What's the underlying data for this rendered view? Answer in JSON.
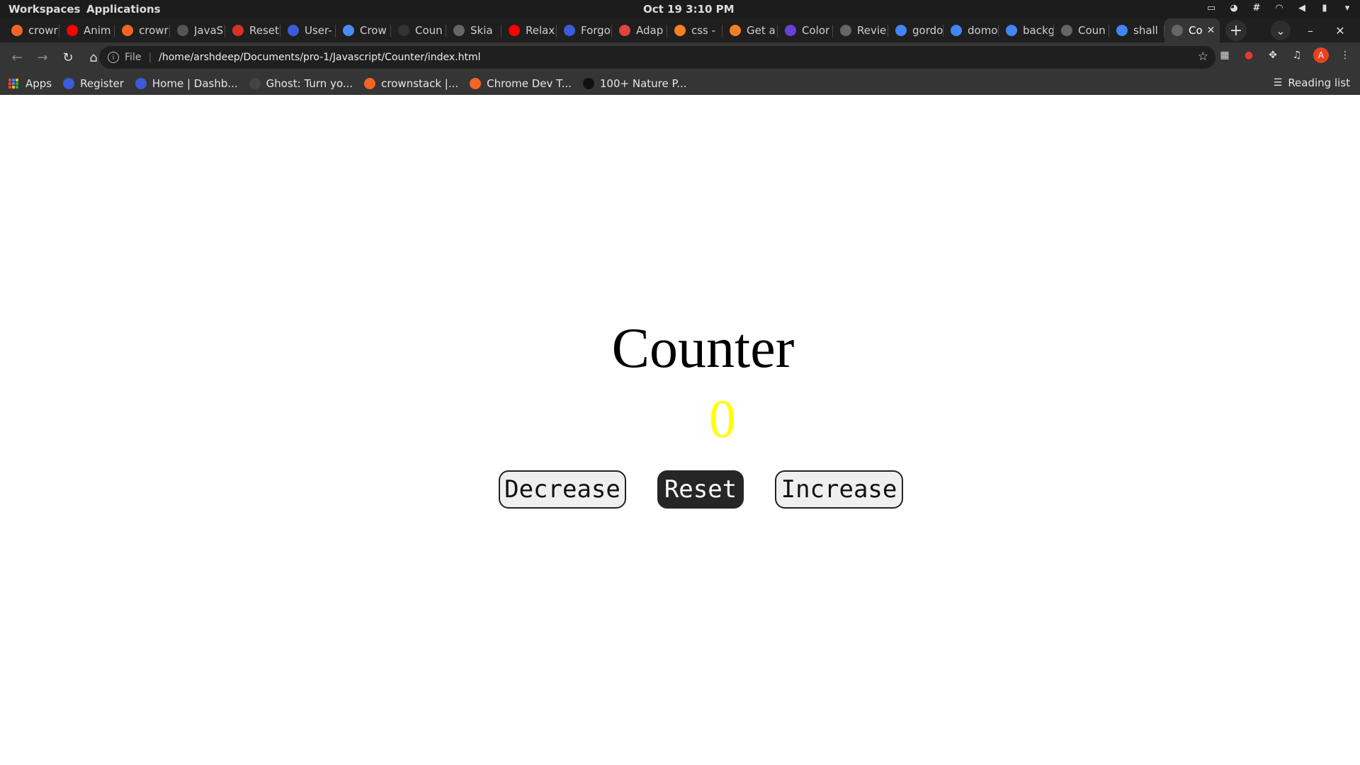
{
  "os": {
    "workspaces": "Workspaces",
    "applications": "Applications",
    "clock": "Oct 19   3:10 PM",
    "tray": [
      "screen-icon",
      "discord-icon",
      "slack-icon",
      "wifi-icon",
      "volume-icon",
      "battery-icon",
      "menu-chevron-icon"
    ]
  },
  "tabs": [
    {
      "title": "crowr",
      "icon": "crownstack-icon",
      "color": "#f26522"
    },
    {
      "title": "Anim",
      "icon": "youtube-icon",
      "color": "#ff0000"
    },
    {
      "title": "crowr",
      "icon": "crownstack-icon",
      "color": "#f26522"
    },
    {
      "title": "JavaS",
      "icon": "bookmark-icon",
      "color": "#555555"
    },
    {
      "title": "Reset",
      "icon": "gmail-icon",
      "color": "#d93025"
    },
    {
      "title": "User-",
      "icon": "k-icon",
      "color": "#3b5bdb"
    },
    {
      "title": "Crow",
      "icon": "tasks-icon",
      "color": "#4c8bf5"
    },
    {
      "title": "Coun",
      "icon": "github-icon",
      "color": "#333333"
    },
    {
      "title": "Skia",
      "icon": "globe-icon",
      "color": "#666666"
    },
    {
      "title": "Relax",
      "icon": "youtube-icon",
      "color": "#ff0000"
    },
    {
      "title": "Forgo",
      "icon": "k-icon",
      "color": "#3b5bdb"
    },
    {
      "title": "Adap",
      "icon": "asterisk-icon",
      "color": "#e0443e"
    },
    {
      "title": "css -",
      "icon": "stackoverflow-icon",
      "color": "#f48024"
    },
    {
      "title": "Get a",
      "icon": "stackoverflow-icon",
      "color": "#f48024"
    },
    {
      "title": "Color",
      "icon": "c-icon",
      "color": "#6741d9"
    },
    {
      "title": "Revie",
      "icon": "globe-icon",
      "color": "#666666"
    },
    {
      "title": "gordo",
      "icon": "google-icon",
      "color": "#4285f4"
    },
    {
      "title": "domo",
      "icon": "google-icon",
      "color": "#4285f4"
    },
    {
      "title": "backg",
      "icon": "google-icon",
      "color": "#4285f4"
    },
    {
      "title": "Coun",
      "icon": "globe-icon",
      "color": "#666666"
    },
    {
      "title": "shall",
      "icon": "google-icon",
      "color": "#4285f4"
    },
    {
      "title": "Co",
      "icon": "globe-icon",
      "color": "#666666",
      "active": true
    }
  ],
  "toolbar": {
    "file_label": "File",
    "url": "/home/arshdeep/Documents/pro-1/Javascript/Counter/index.html"
  },
  "bookmarks": {
    "apps": "Apps",
    "items": [
      {
        "label": "Register",
        "icon": "k-icon",
        "color": "#3b5bdb"
      },
      {
        "label": "Home | Dashb...",
        "icon": "k-icon",
        "color": "#3b5bdb"
      },
      {
        "label": "Ghost: Turn yo...",
        "icon": "ghost-icon",
        "color": "#444444"
      },
      {
        "label": "crownstack |...",
        "icon": "crownstack-icon",
        "color": "#f26522"
      },
      {
        "label": "Chrome Dev T...",
        "icon": "crownstack-icon",
        "color": "#f26522"
      },
      {
        "label": "100+ Nature P...",
        "icon": "unsplash-icon",
        "color": "#111111"
      }
    ],
    "reading_list": "Reading list"
  },
  "counter": {
    "title": "Counter",
    "value": "0",
    "value_color": "#ffff00",
    "decrease": "Decrease",
    "reset": "Reset",
    "increase": "Increase"
  }
}
